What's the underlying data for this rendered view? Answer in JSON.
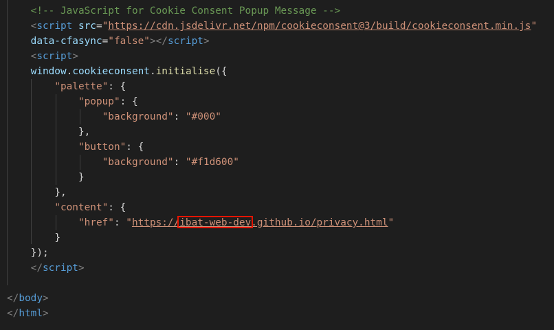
{
  "editor": {
    "theme": "dark",
    "background": "#1e1e1e",
    "highlight_color": "#e51400",
    "lines": [
      {
        "indent": "    ",
        "parts": [
          {
            "cls": "c-comment",
            "text": "<!-- JavaScript for Cookie Consent Popup Message -->"
          }
        ]
      },
      {
        "indent": "    ",
        "parts": [
          {
            "cls": "c-punct",
            "text": "<"
          },
          {
            "cls": "c-tag",
            "text": "script"
          },
          {
            "cls": "c-text",
            "text": " "
          },
          {
            "cls": "c-attr",
            "text": "src"
          },
          {
            "cls": "c-text",
            "text": "="
          },
          {
            "cls": "c-str",
            "text": "\""
          },
          {
            "cls": "c-link",
            "text": "https://cdn.jsdelivr.net/npm/cookieconsent@3/build/cookieconsent.min.js"
          },
          {
            "cls": "c-str",
            "text": "\""
          }
        ]
      },
      {
        "indent": "    ",
        "parts": [
          {
            "cls": "c-attr",
            "text": "data-cfasync"
          },
          {
            "cls": "c-text",
            "text": "="
          },
          {
            "cls": "c-str",
            "text": "\"false\""
          },
          {
            "cls": "c-punct",
            "text": "></"
          },
          {
            "cls": "c-tag",
            "text": "script"
          },
          {
            "cls": "c-punct",
            "text": ">"
          }
        ]
      },
      {
        "indent": "    ",
        "parts": [
          {
            "cls": "c-punct",
            "text": "<"
          },
          {
            "cls": "c-tag",
            "text": "script"
          },
          {
            "cls": "c-punct",
            "text": ">"
          }
        ]
      },
      {
        "indent": "    ",
        "parts": [
          {
            "cls": "c-var",
            "text": "window"
          },
          {
            "cls": "c-text",
            "text": "."
          },
          {
            "cls": "c-var",
            "text": "cookieconsent"
          },
          {
            "cls": "c-text",
            "text": "."
          },
          {
            "cls": "c-func",
            "text": "initialise"
          },
          {
            "cls": "c-text",
            "text": "({"
          }
        ]
      },
      {
        "indent": "        ",
        "parts": [
          {
            "cls": "c-str",
            "text": "\"palette\""
          },
          {
            "cls": "c-text",
            "text": ": {"
          }
        ]
      },
      {
        "indent": "            ",
        "parts": [
          {
            "cls": "c-str",
            "text": "\"popup\""
          },
          {
            "cls": "c-text",
            "text": ": {"
          }
        ]
      },
      {
        "indent": "                ",
        "parts": [
          {
            "cls": "c-str",
            "text": "\"background\""
          },
          {
            "cls": "c-text",
            "text": ": "
          },
          {
            "cls": "c-str",
            "text": "\"#000\""
          }
        ]
      },
      {
        "indent": "            ",
        "parts": [
          {
            "cls": "c-text",
            "text": "},"
          }
        ]
      },
      {
        "indent": "            ",
        "parts": [
          {
            "cls": "c-str",
            "text": "\"button\""
          },
          {
            "cls": "c-text",
            "text": ": {"
          }
        ]
      },
      {
        "indent": "                ",
        "parts": [
          {
            "cls": "c-str",
            "text": "\"background\""
          },
          {
            "cls": "c-text",
            "text": ": "
          },
          {
            "cls": "c-str",
            "text": "\"#f1d600\""
          }
        ]
      },
      {
        "indent": "            ",
        "parts": [
          {
            "cls": "c-text",
            "text": "}"
          }
        ]
      },
      {
        "indent": "        ",
        "parts": [
          {
            "cls": "c-text",
            "text": "},"
          }
        ]
      },
      {
        "indent": "        ",
        "parts": [
          {
            "cls": "c-str",
            "text": "\"content\""
          },
          {
            "cls": "c-text",
            "text": ": {"
          }
        ]
      },
      {
        "indent": "            ",
        "parts": [
          {
            "cls": "c-str",
            "text": "\"href\""
          },
          {
            "cls": "c-text",
            "text": ": "
          },
          {
            "cls": "c-str",
            "text": "\""
          },
          {
            "cls": "c-link",
            "text": "https://"
          },
          {
            "cls": "c-link hl",
            "text": "ibat-web-dev"
          },
          {
            "cls": "c-link",
            "text": ".github.io/privacy.html"
          },
          {
            "cls": "c-str",
            "text": "\""
          }
        ]
      },
      {
        "indent": "        ",
        "parts": [
          {
            "cls": "c-text",
            "text": "}"
          }
        ]
      },
      {
        "indent": "    ",
        "parts": [
          {
            "cls": "c-text",
            "text": "});"
          }
        ]
      },
      {
        "indent": "    ",
        "parts": [
          {
            "cls": "c-punct",
            "text": "</"
          },
          {
            "cls": "c-tag",
            "text": "script"
          },
          {
            "cls": "c-punct",
            "text": ">"
          }
        ]
      },
      {
        "indent": "",
        "parts": []
      },
      {
        "indent": "",
        "parts": [
          {
            "cls": "c-punct",
            "text": "</"
          },
          {
            "cls": "c-tag",
            "text": "body"
          },
          {
            "cls": "c-punct",
            "text": ">"
          }
        ]
      },
      {
        "indent": "",
        "parts": [
          {
            "cls": "c-punct",
            "text": "</"
          },
          {
            "cls": "c-tag",
            "text": "html"
          },
          {
            "cls": "c-punct",
            "text": ">"
          }
        ]
      }
    ]
  }
}
